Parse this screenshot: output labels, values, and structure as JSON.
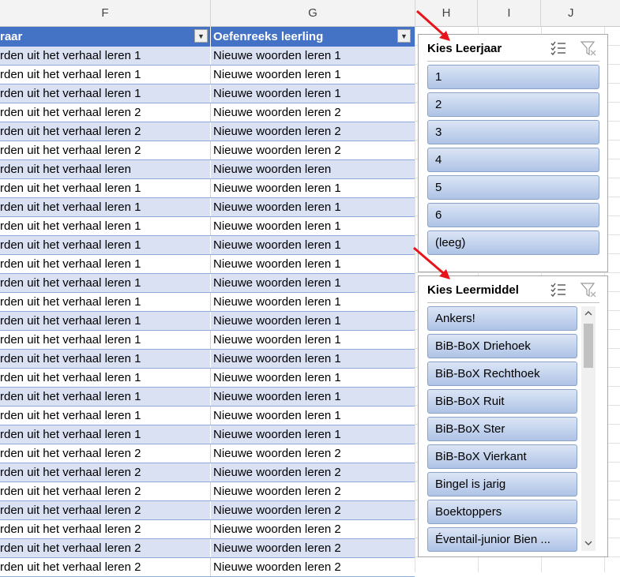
{
  "columns": [
    {
      "letter": "F"
    },
    {
      "letter": "G"
    },
    {
      "letter": "H"
    },
    {
      "letter": "I"
    },
    {
      "letter": "J"
    }
  ],
  "table": {
    "headers": {
      "f": "raar",
      "g": "Oefenreeks leerling"
    },
    "rows": [
      {
        "f": "rden uit het verhaal  leren 1",
        "g": "Nieuwe woorden leren 1"
      },
      {
        "f": "rden uit het verhaal  leren 1",
        "g": "Nieuwe woorden leren 1"
      },
      {
        "f": "rden uit het verhaal  leren 1",
        "g": "Nieuwe woorden leren 1"
      },
      {
        "f": "rden uit het verhaal  leren 2",
        "g": "Nieuwe woorden leren 2"
      },
      {
        "f": "rden uit het verhaal  leren 2",
        "g": "Nieuwe woorden leren 2"
      },
      {
        "f": "rden uit het verhaal  leren 2",
        "g": "Nieuwe woorden leren 2"
      },
      {
        "f": "rden uit het verhaal leren",
        "g": "Nieuwe woorden leren"
      },
      {
        "f": "rden uit het verhaal leren 1",
        "g": "Nieuwe woorden leren 1"
      },
      {
        "f": "rden uit het verhaal leren 1",
        "g": "Nieuwe woorden leren 1"
      },
      {
        "f": "rden uit het verhaal leren 1",
        "g": "Nieuwe woorden leren 1"
      },
      {
        "f": "rden uit het verhaal leren 1",
        "g": "Nieuwe woorden leren 1"
      },
      {
        "f": "rden uit het verhaal leren 1",
        "g": "Nieuwe woorden leren 1"
      },
      {
        "f": "rden uit het verhaal leren 1",
        "g": "Nieuwe woorden leren 1"
      },
      {
        "f": "rden uit het verhaal leren 1",
        "g": "Nieuwe woorden leren 1"
      },
      {
        "f": "rden uit het verhaal leren 1",
        "g": "Nieuwe woorden leren 1"
      },
      {
        "f": "rden uit het verhaal leren 1",
        "g": "Nieuwe woorden leren 1"
      },
      {
        "f": "rden uit het verhaal leren 1",
        "g": "Nieuwe woorden leren 1"
      },
      {
        "f": "rden uit het verhaal leren 1",
        "g": "Nieuwe woorden leren 1"
      },
      {
        "f": "rden uit het verhaal leren 1",
        "g": "Nieuwe woorden leren 1"
      },
      {
        "f": "rden uit het verhaal leren 1",
        "g": "Nieuwe woorden leren 1"
      },
      {
        "f": "rden uit het verhaal leren 1",
        "g": "Nieuwe woorden leren 1"
      },
      {
        "f": "rden uit het verhaal leren 2",
        "g": "Nieuwe woorden leren 2"
      },
      {
        "f": "rden uit het verhaal leren 2",
        "g": "Nieuwe woorden leren 2"
      },
      {
        "f": "rden uit het verhaal leren 2",
        "g": "Nieuwe woorden leren 2"
      },
      {
        "f": "rden uit het verhaal leren 2",
        "g": "Nieuwe woorden leren 2"
      },
      {
        "f": "rden uit het verhaal leren 2",
        "g": "Nieuwe woorden leren 2"
      },
      {
        "f": "rden uit het verhaal leren 2",
        "g": "Nieuwe woorden leren 2"
      },
      {
        "f": "rden uit het verhaal leren 2",
        "g": "Nieuwe woorden leren 2"
      }
    ]
  },
  "slicer_leerjaar": {
    "title": "Kies Leerjaar",
    "icons": [
      "multi-select-icon",
      "clear-filter-icon"
    ],
    "items": [
      "1",
      "2",
      "3",
      "4",
      "5",
      "6",
      "(leeg)"
    ]
  },
  "slicer_leermiddel": {
    "title": "Kies Leermiddel",
    "icons": [
      "multi-select-icon",
      "clear-filter-icon"
    ],
    "items": [
      "Ankers!",
      "BiB-BoX Driehoek",
      "BiB-BoX Rechthoek",
      "BiB-BoX Ruit",
      "BiB-BoX Ster",
      "BiB-BoX Vierkant",
      "Bingel is jarig",
      "Boektoppers",
      "Éventail-junior Bien ..."
    ]
  },
  "colors": {
    "table_header": "#4472c4",
    "band_row": "#d9e1f2",
    "slicer_item_top": "#dbe5f5",
    "slicer_item_bottom": "#aec3e6",
    "annotation_arrow": "#e8141c"
  }
}
